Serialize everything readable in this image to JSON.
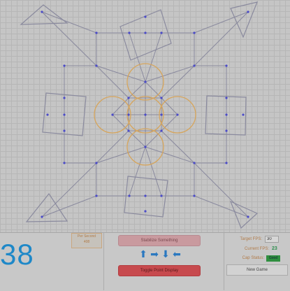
{
  "score": "38",
  "per_second": {
    "label": "Per Second",
    "value": "408"
  },
  "buttons": {
    "stabilize": "Stabilize Something",
    "toggle": "Toggle Point Display",
    "new_game": "New Game"
  },
  "arrows": [
    "⬆",
    "➡",
    "⬇",
    "⬅"
  ],
  "stats": {
    "target_fps_label": "Target FPS:",
    "target_fps_value": "30",
    "current_fps_label": "Current FPS:",
    "current_fps_value": "23",
    "cap_status_label": "Cap Status:",
    "cap_status_value": "Good"
  },
  "colors": {
    "line": "#8a8a9e",
    "point": "#4a4ac8",
    "circle": "#d6a55c",
    "score": "#1e88c8"
  }
}
